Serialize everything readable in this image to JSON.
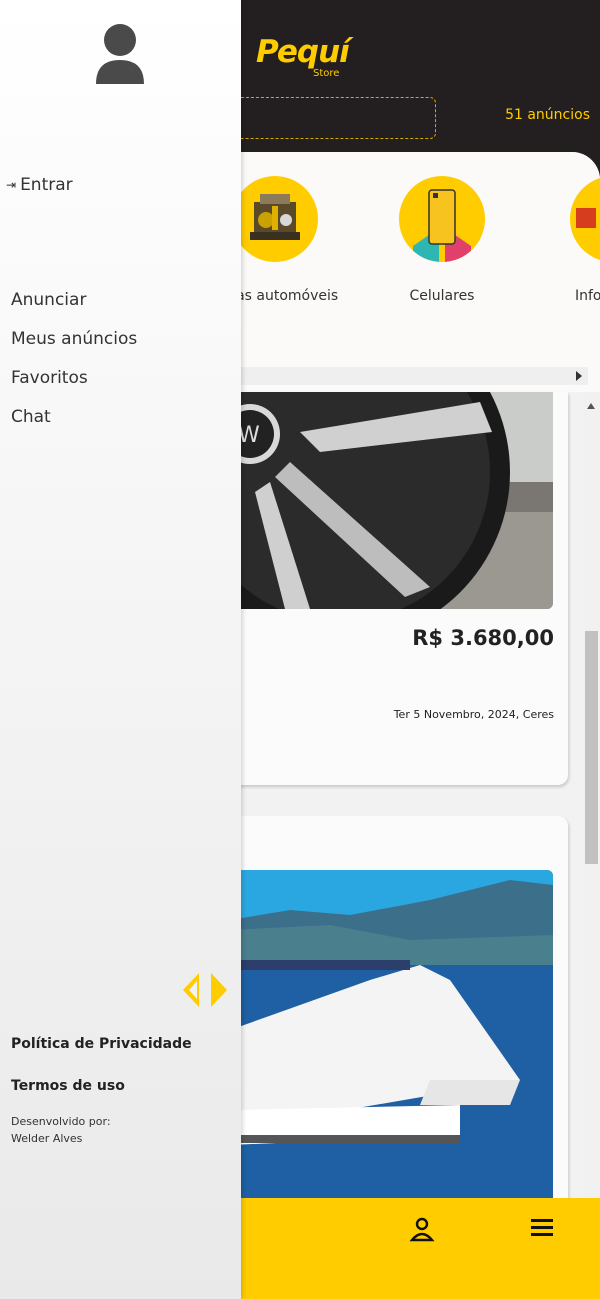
{
  "header": {
    "logo": "Pequí",
    "logo_sub": "Store",
    "ad_count": "51 anúncios"
  },
  "categories": [
    {
      "label": "Peças automóveis",
      "icon": "engine-icon"
    },
    {
      "label": "Celulares",
      "icon": "smartphone-icon"
    },
    {
      "label": "Informática",
      "icon": "informatics-icon"
    }
  ],
  "listings": [
    {
      "price": "R$ 3.680,00",
      "date": "Ter 5 Novembro, 2024, Ceres",
      "image": "car-wheel-photo"
    },
    {
      "image": "boat-photo"
    }
  ],
  "drawer": {
    "login_label": "Entrar",
    "menu": [
      "Anunciar",
      "Meus anúncios",
      "Favoritos",
      "Chat"
    ],
    "privacy": "Política de Privacidade",
    "terms": "Termos de uso",
    "dev_label": "Desenvolvido por:",
    "dev_name": "Welder Alves"
  },
  "colors": {
    "accent": "#ffcc00",
    "header_bg": "#231f20"
  }
}
